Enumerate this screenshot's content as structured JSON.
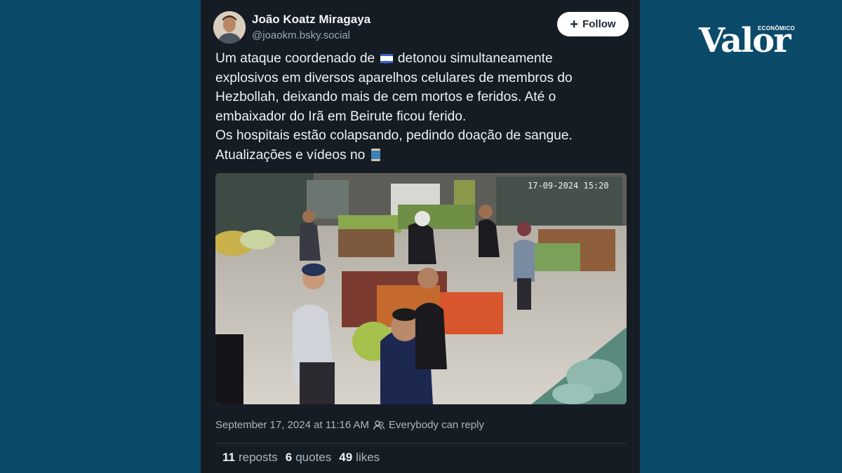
{
  "author": {
    "name": "João Koatz Miragaya",
    "handle": "@joaokm.bsky.social"
  },
  "follow_button": {
    "label": "Follow",
    "icon": "plus-icon"
  },
  "post": {
    "lines": [
      {
        "before": "Um ataque coordenado de ",
        "icon": "israel-flag-icon",
        "after": " detonou simultaneamente"
      },
      {
        "text": "explosivos em diversos aparelhos celulares de membros do"
      },
      {
        "text": "Hezbollah, deixando mais de cem mortos e feridos. Até o"
      },
      {
        "text": "embaixador do Irã em Beirute ficou ferido."
      },
      {
        "text": "Os hospitais estão colapsando, pedindo doação de sangue."
      },
      {
        "before": "Atualizações e vídeos no ",
        "icon": "thread-spool-icon"
      }
    ]
  },
  "media": {
    "overlay_timestamp": "17-09-2024 15:20"
  },
  "meta": {
    "timestamp": "September 17, 2024 at 11:16 AM",
    "reply_setting": "Everybody can reply",
    "reply_icon": "people-icon"
  },
  "stats": {
    "reposts_count": "11",
    "reposts_label": "reposts",
    "quotes_count": "6",
    "quotes_label": "quotes",
    "likes_count": "49",
    "likes_label": "likes"
  },
  "brand": {
    "word": "Valor",
    "sub": "ECONÔMICO"
  },
  "colors": {
    "background": "#0b4a68",
    "card": "#151c24",
    "text": "#eef2f6",
    "muted": "#aab6c2"
  }
}
